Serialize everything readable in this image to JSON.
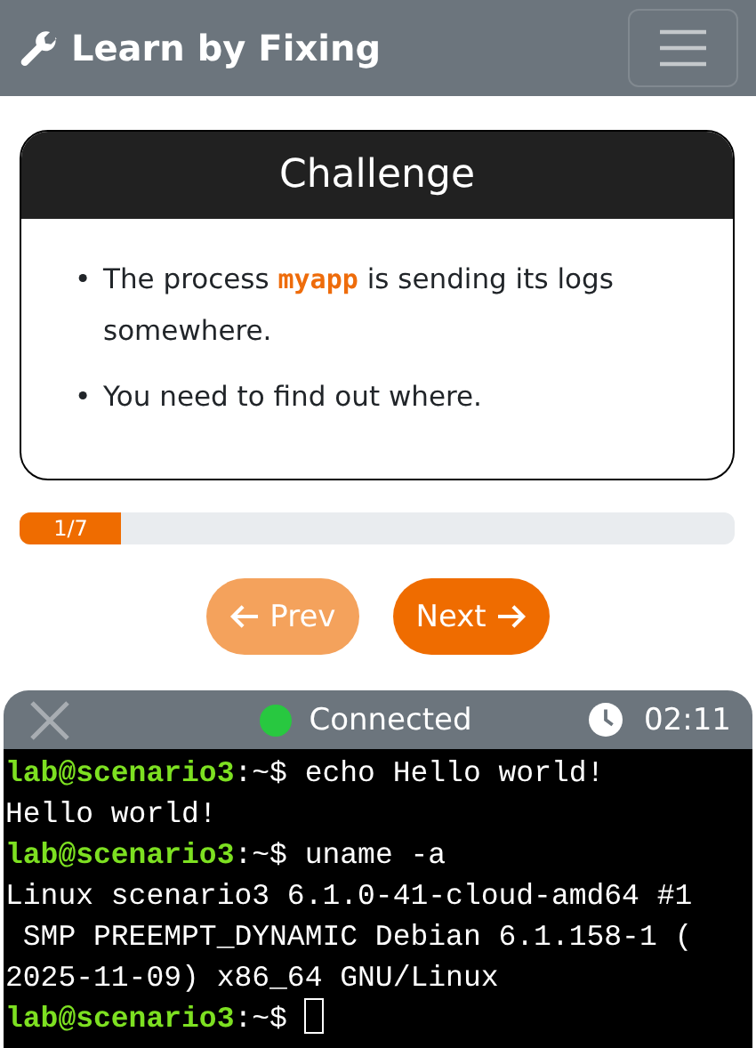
{
  "navbar": {
    "brand": "Learn by Fixing"
  },
  "challenge": {
    "title": "Challenge",
    "items": [
      {
        "bullet": "•",
        "text": "The process **myapp** is sending its logs somewhere."
      },
      {
        "bullet": "•",
        "text": "You need to find out where."
      }
    ]
  },
  "progress": {
    "label": "1/7",
    "level": 0.143
  },
  "buttons": [
    {
      "label": "Prev",
      "kind": "prev",
      "disabled": true
    },
    {
      "label": "Next",
      "kind": "next",
      "disabled": false
    }
  ],
  "terminal": {
    "status": "Connected",
    "connected": true,
    "time": "02:11",
    "lines": [
      {
        "kind": "prompt",
        "user": "lab@scenario3",
        "path": ":~$",
        "command": "echo Hello world!"
      },
      {
        "kind": "output",
        "text": "Hello world!"
      },
      {
        "kind": "prompt",
        "user": "lab@scenario3",
        "path": ":~$",
        "command": "uname -a"
      },
      {
        "kind": "output",
        "text": "Linux scenario3 6.1.0-41-cloud-amd64 #1"
      },
      {
        "kind": "output",
        "text": " SMP PREEMPT_DYNAMIC Debian 6.1.158-1 ("
      },
      {
        "kind": "output",
        "text": "2025-11-09) x86_64 GNU/Linux"
      },
      {
        "kind": "prompt",
        "user": "lab@scenario3",
        "path": ":~$",
        "cursor": true
      }
    ]
  }
}
